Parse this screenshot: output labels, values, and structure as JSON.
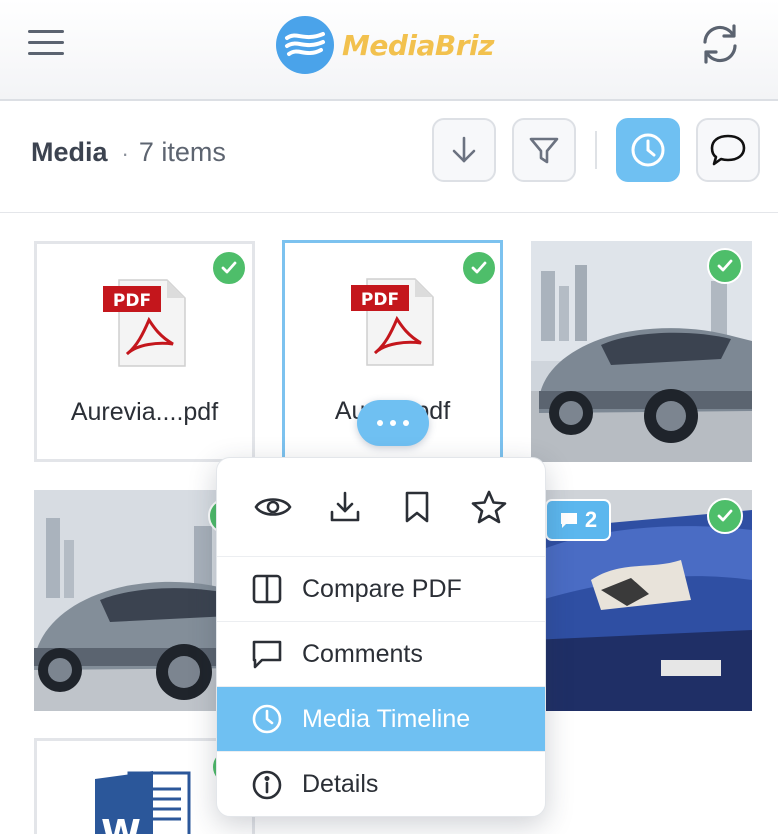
{
  "header": {
    "brand": "MediaBriz",
    "brand_color": "#f2c14e",
    "accent": "#4aa3ea"
  },
  "toolbar": {
    "title": "Media",
    "separator": "·",
    "count": "7 items",
    "buttons": [
      {
        "name": "download",
        "icon": "arrow-down-icon"
      },
      {
        "name": "filter",
        "icon": "filter-icon"
      },
      {
        "name": "timeline",
        "icon": "clock-icon",
        "active": true
      },
      {
        "name": "comments",
        "icon": "speech-bubble-icon"
      }
    ]
  },
  "media": {
    "items": [
      {
        "kind": "pdf",
        "name": "Aurevia....pdf",
        "checked": true
      },
      {
        "kind": "pdf",
        "name": "Aure....pdf",
        "checked": true,
        "selected": true
      },
      {
        "kind": "image",
        "subject": "silver SUV",
        "checked": true
      },
      {
        "kind": "image",
        "subject": "silver SUV",
        "checked": true
      },
      {
        "kind": "image",
        "subject": "damaged blue car",
        "checked": true,
        "comments": "2"
      },
      {
        "kind": "word",
        "checked": true
      }
    ]
  },
  "context_menu": {
    "quick_actions": [
      "eye-icon",
      "download-icon",
      "bookmark-icon",
      "star-icon"
    ],
    "items": [
      {
        "label": "Compare PDF",
        "icon": "split-view-icon"
      },
      {
        "label": "Comments",
        "icon": "comment-icon"
      },
      {
        "label": "Media Timeline",
        "icon": "clock-icon",
        "active": true
      },
      {
        "label": "Details",
        "icon": "info-icon"
      }
    ]
  },
  "colors": {
    "check": "#4ebe6a",
    "active": "#6fc0f2"
  }
}
